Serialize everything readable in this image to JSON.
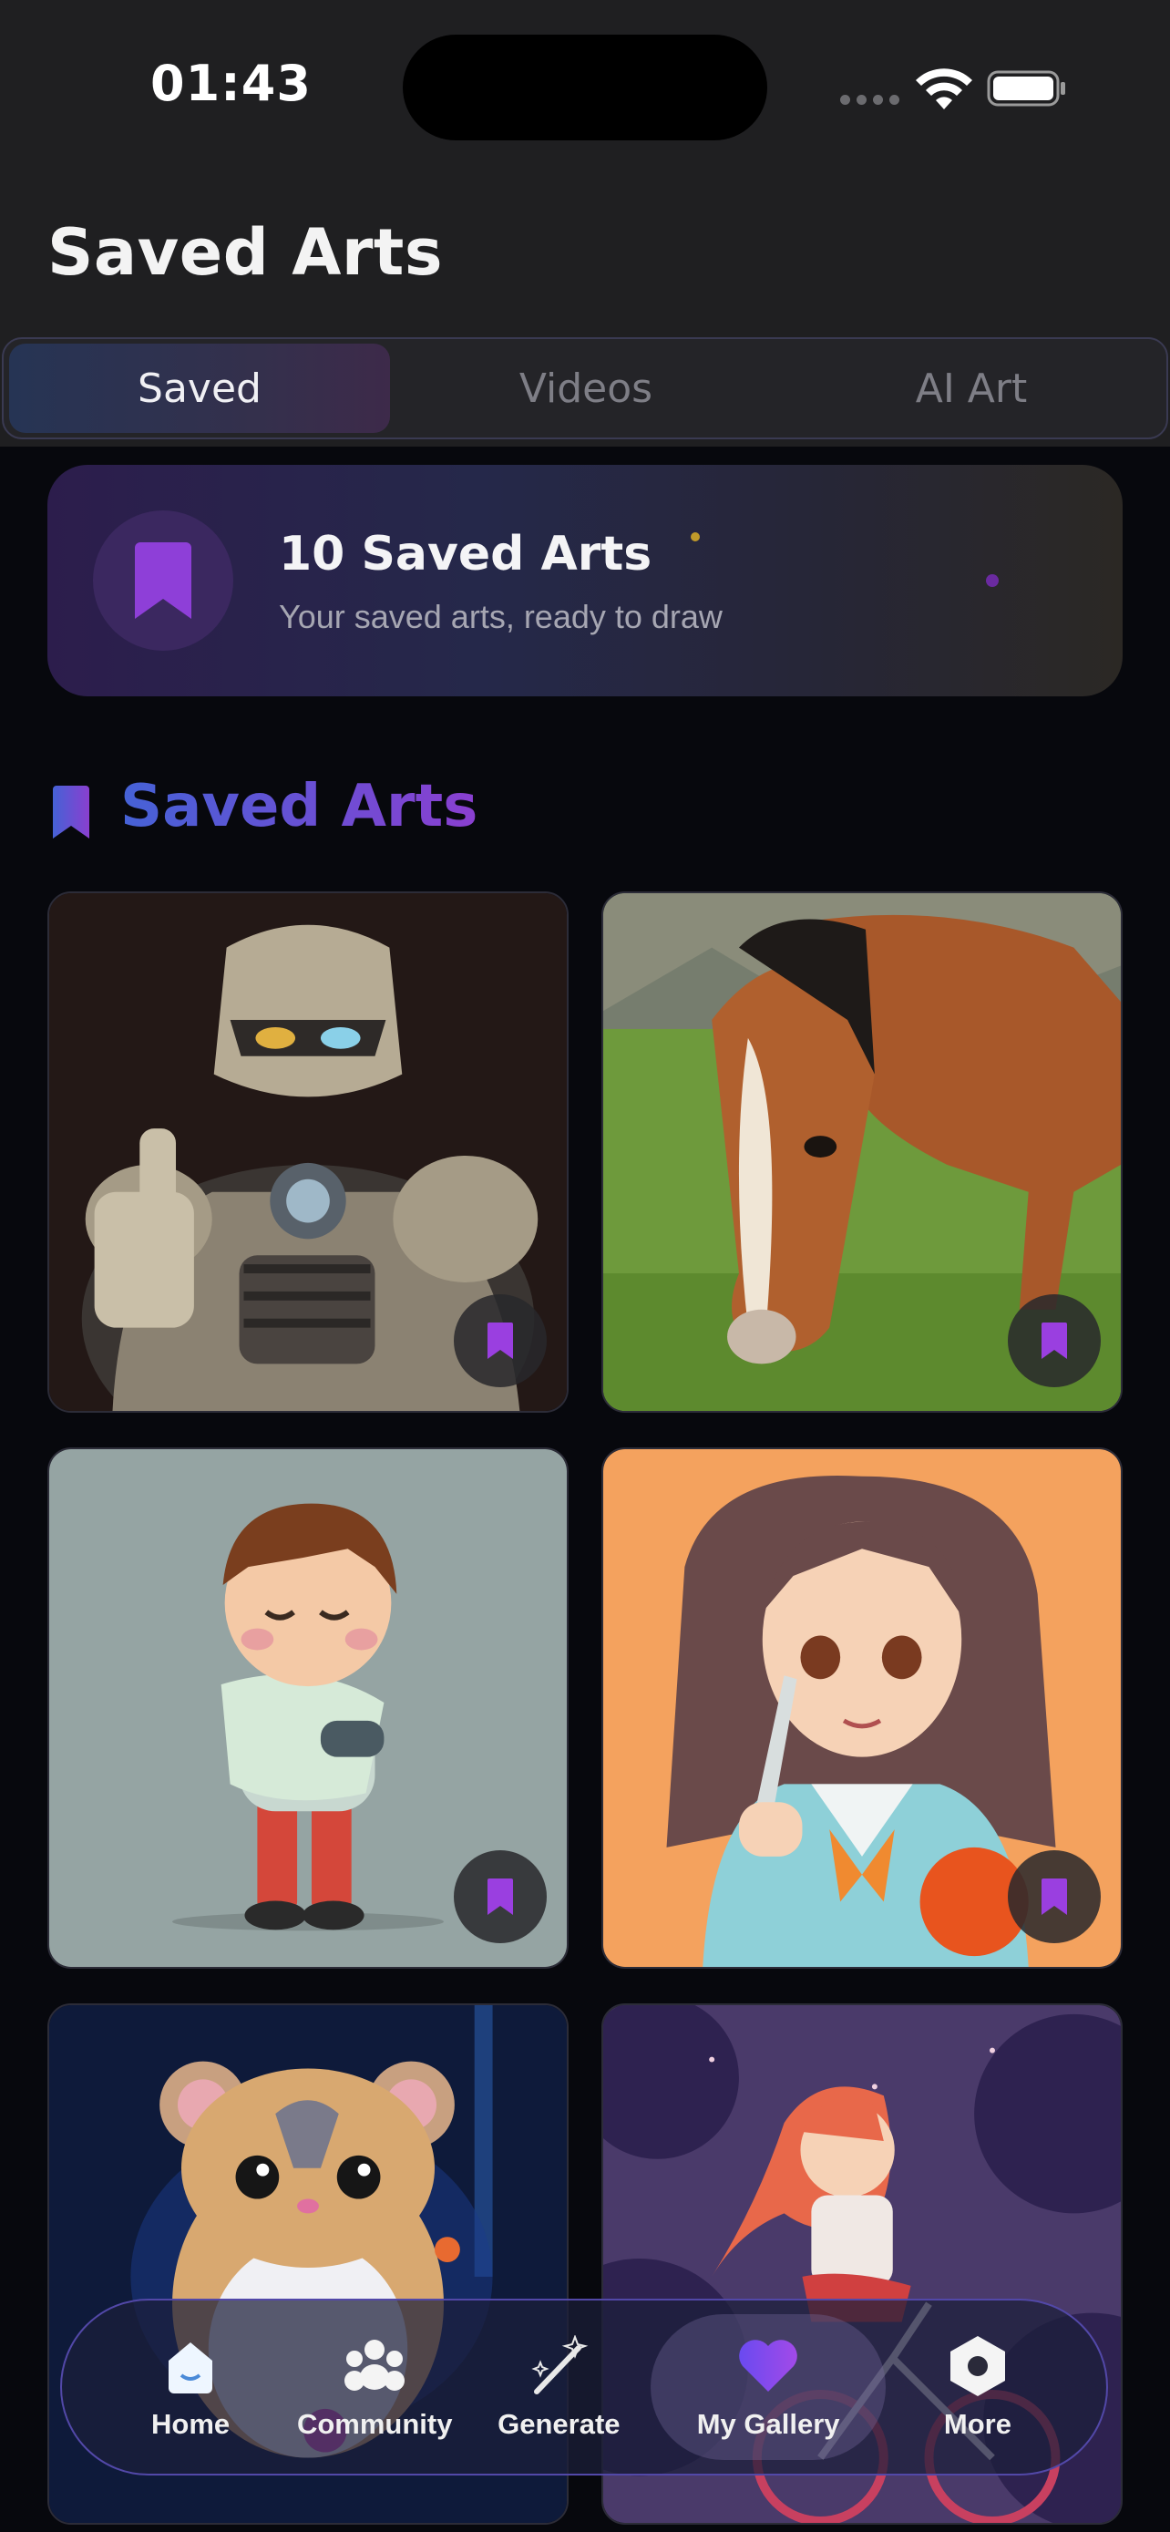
{
  "status_bar": {
    "time": "01:43"
  },
  "header": {
    "title": "Saved Arts"
  },
  "tabs": [
    {
      "label": "Saved",
      "active": true
    },
    {
      "label": "Videos",
      "active": false
    },
    {
      "label": "AI Art",
      "active": false
    }
  ],
  "summary": {
    "icon": "bookmark-icon",
    "title": "10 Saved Arts",
    "subtitle": "Your saved arts, ready to draw"
  },
  "section": {
    "icon": "bookmark-icon",
    "title": "Saved Arts"
  },
  "gallery": [
    {
      "subject": "robot-thumbs-up",
      "saved": true
    },
    {
      "subject": "horse-grazing",
      "saved": true
    },
    {
      "subject": "boy-hugging-pillow",
      "saved": true
    },
    {
      "subject": "girl-with-knife-and-orange",
      "saved": true
    },
    {
      "subject": "hamster",
      "saved": true
    },
    {
      "subject": "girl-on-bicycle",
      "saved": true
    }
  ],
  "bottom_nav": [
    {
      "label": "Home",
      "icon": "home-icon",
      "active": false
    },
    {
      "label": "Community",
      "icon": "community-icon",
      "active": false
    },
    {
      "label": "Generate",
      "icon": "magic-wand-icon",
      "active": false
    },
    {
      "label": "My Gallery",
      "icon": "heart-icon",
      "active": true
    },
    {
      "label": "More",
      "icon": "hexagon-icon",
      "active": false
    }
  ],
  "colors": {
    "accent_purple": "#8a3fd0",
    "accent_blue": "#4562d6",
    "background": "#07080d",
    "header_background": "#1f1f21"
  }
}
